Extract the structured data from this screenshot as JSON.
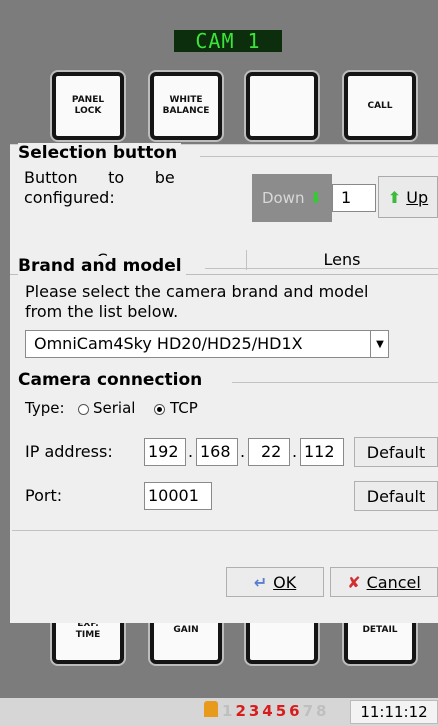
{
  "display": {
    "text": "CAM 1"
  },
  "hardware_buttons": {
    "top": [
      "PANEL\nLOCK",
      "WHITE\nBALANCE",
      "",
      "CALL"
    ],
    "bottom": [
      "EXP.\nTIME",
      "GAIN",
      "",
      "DETAIL"
    ]
  },
  "dialog": {
    "selection": {
      "title": "Selection button",
      "label_line1": "Button      to      be",
      "label_line2": "configured:",
      "down_label": "Down",
      "value": "1",
      "up_label": "Up"
    },
    "tabs": [
      {
        "label": "Camera"
      },
      {
        "label": "Lens"
      }
    ],
    "brand": {
      "title": "Brand and model",
      "instruction_line1": "Please select the camera brand and model",
      "instruction_line2": "from the list below.",
      "selected": "OmniCam4Sky HD20/HD25/HD1X"
    },
    "connection": {
      "title": "Camera connection",
      "type_label": "Type:",
      "options": [
        "Serial",
        "TCP"
      ],
      "selected_option": "TCP",
      "ip_label": "IP address:",
      "ip": [
        "192",
        "168",
        "22",
        "112"
      ],
      "port_label": "Port:",
      "port": "10001",
      "default_label": "Default"
    },
    "ok_label": "OK",
    "cancel_label": "Cancel"
  },
  "status": {
    "active_numbers": "23456",
    "inactive_numbers": "78",
    "inactive_prefix": "1",
    "time": "11:11:12"
  },
  "colors": {
    "display_text": "#3be33b",
    "accent_red": "#d81c1c",
    "arrow_green": "#33cc33"
  }
}
